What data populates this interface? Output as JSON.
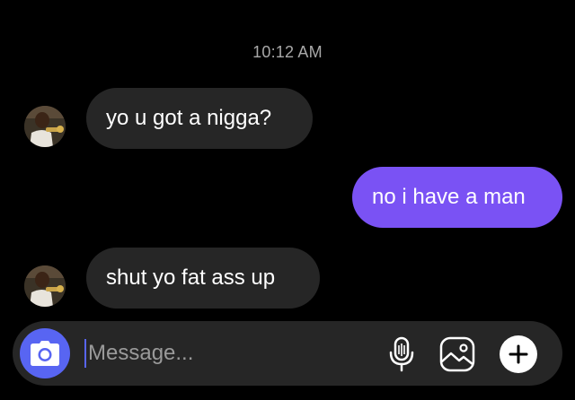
{
  "header": {
    "timestamp": "10:12 AM"
  },
  "messages": [
    {
      "direction": "incoming",
      "text": "yo u got a nigga?",
      "avatar": "contact-avatar"
    },
    {
      "direction": "outgoing",
      "text": "no i have a man"
    },
    {
      "direction": "incoming",
      "text": "shut yo fat ass up",
      "avatar": "contact-avatar"
    }
  ],
  "composer": {
    "placeholder": "Message...",
    "value": "",
    "icons": [
      "camera-icon",
      "microphone-icon",
      "gallery-icon",
      "plus-icon"
    ]
  },
  "colors": {
    "background": "#000000",
    "incoming_bubble": "#262626",
    "outgoing_bubble": "#7a52f4",
    "camera_button": "#5865f2",
    "timestamp_text": "#a8a8a8"
  }
}
